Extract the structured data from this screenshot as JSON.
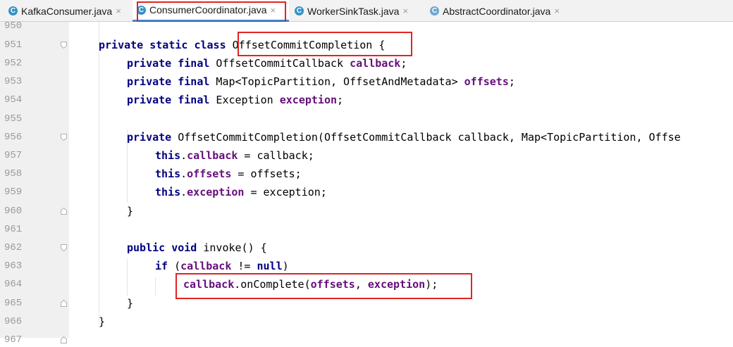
{
  "tabs": [
    {
      "label": "KafkaConsumer.java",
      "icon": "C",
      "active": false
    },
    {
      "label": "ConsumerCoordinator.java",
      "icon": "C",
      "active": true
    },
    {
      "label": "WorkerSinkTask.java",
      "icon": "C",
      "active": false
    },
    {
      "label": "AbstractCoordinator.java",
      "icon": "C",
      "active": false
    }
  ],
  "tab_close_glyph": "×",
  "accent_color": "#4a86c8",
  "highlight_color": "#e02424",
  "line_numbers": [
    "950",
    "951",
    "952",
    "953",
    "954",
    "955",
    "956",
    "957",
    "958",
    "959",
    "960",
    "961",
    "962",
    "963",
    "964",
    "965",
    "966",
    "967"
  ],
  "code": {
    "l951": {
      "kw1": "private static class",
      "name": "OffsetCommitCompletion",
      "tail": " {"
    },
    "l952": {
      "kw": "private final",
      "type": " OffsetCommitCallback ",
      "field": "callback",
      "end": ";"
    },
    "l953": {
      "kw": "private final",
      "type": " Map<TopicPartition, OffsetAndMetadata> ",
      "field": "offsets",
      "end": ";"
    },
    "l954": {
      "kw": "private final",
      "type": " Exception ",
      "field": "exception",
      "end": ";"
    },
    "l956": {
      "kw": "private",
      "rest": " OffsetCommitCompletion(OffsetCommitCallback callback, Map<TopicPartition, Offse"
    },
    "l957": {
      "kw": "this",
      "dot": ".",
      "field": "callback",
      "rest": " = callback;"
    },
    "l958": {
      "kw": "this",
      "dot": ".",
      "field": "offsets",
      "rest": " = offsets;"
    },
    "l959": {
      "kw": "this",
      "dot": ".",
      "field": "exception",
      "rest": " = exception;"
    },
    "l960": {
      "brace": "}"
    },
    "l962": {
      "kw": "public void",
      "rest": " invoke() {"
    },
    "l963": {
      "kw": "if",
      "open": " (",
      "field": "callback",
      "mid": " != ",
      "kw2": "null",
      "close": ")"
    },
    "l964": {
      "field1": "callback",
      "mid": ".onComplete(",
      "field2": "offsets",
      "comma": ", ",
      "field3": "exception",
      "end": ");"
    },
    "l965": {
      "brace": "}"
    },
    "l966": {
      "brace": "}"
    }
  }
}
